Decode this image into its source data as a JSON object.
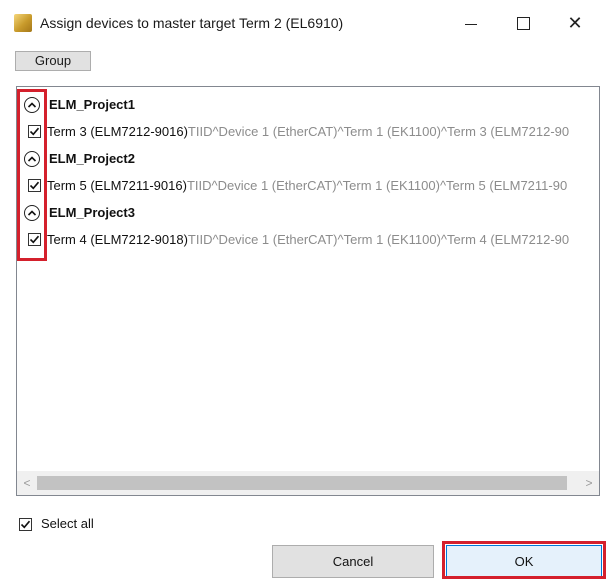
{
  "window": {
    "title": "Assign devices to master target Term 2 (EL6910)",
    "icon": "twincat-app-icon",
    "controls": [
      "minimize-icon",
      "maximize-icon",
      "close-icon"
    ],
    "close_glyph": "✕"
  },
  "toolbar": {
    "group_label": "Group"
  },
  "groups": [
    {
      "name": "ELM_Project1",
      "expanded": true,
      "items": [
        {
          "checked": true,
          "name": "Term 3 (ELM7212-9016)",
          "path": "TIID^Device 1 (EtherCAT)^Term 1 (EK1100)^Term 3 (ELM7212-90"
        }
      ]
    },
    {
      "name": "ELM_Project2",
      "expanded": true,
      "items": [
        {
          "checked": true,
          "name": "Term 5 (ELM7211-9016)",
          "path": "TIID^Device 1 (EtherCAT)^Term 1 (EK1100)^Term 5 (ELM7211-90"
        }
      ]
    },
    {
      "name": "ELM_Project3",
      "expanded": true,
      "items": [
        {
          "checked": true,
          "name": "Term 4 (ELM7212-9018)",
          "path": "TIID^Device 1 (EtherCAT)^Term 1 (EK1100)^Term 4 (ELM7212-90"
        }
      ]
    }
  ],
  "scrollbar": {
    "left_glyph": "<",
    "right_glyph": ">"
  },
  "footer": {
    "select_all_label": "Select all",
    "select_all_checked": true,
    "cancel_label": "Cancel",
    "ok_label": "OK"
  },
  "colors": {
    "highlight": "#d4202c",
    "ok_border": "#0078d7",
    "path_text": "#8c8c8c"
  }
}
